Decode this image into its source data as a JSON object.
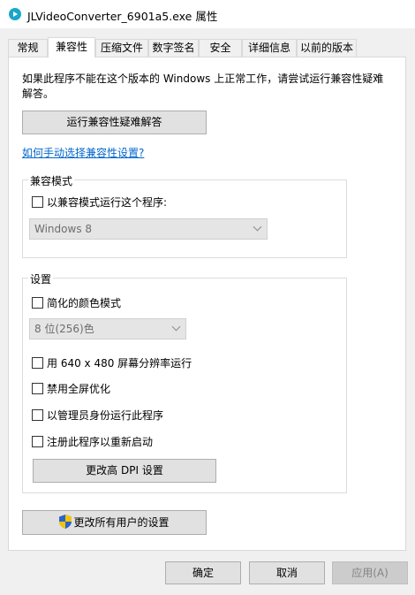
{
  "window": {
    "title": "JLVideoConverter_6901a5.exe 属性"
  },
  "tabs": [
    {
      "label": "常规"
    },
    {
      "label": "兼容性"
    },
    {
      "label": "压缩文件"
    },
    {
      "label": "数字签名"
    },
    {
      "label": "安全"
    },
    {
      "label": "详细信息"
    },
    {
      "label": "以前的版本"
    }
  ],
  "compat": {
    "intro": "如果此程序不能在这个版本的 Windows 上正常工作，请尝试运行兼容性疑难解答。",
    "troubleshoot_button": "运行兼容性疑难解答",
    "manual_link": "如何手动选择兼容性设置?",
    "mode_group": {
      "title": "兼容模式",
      "checkbox_label": "以兼容模式运行这个程序:",
      "os_select_value": "Windows 8"
    },
    "settings_group": {
      "title": "设置",
      "reduced_color": "简化的颜色模式",
      "color_select_value": "8 位(256)色",
      "res_640": "用 640 x 480 屏幕分辨率运行",
      "disable_fullscreen": "禁用全屏优化",
      "run_as_admin": "以管理员身份运行此程序",
      "register_restart": "注册此程序以重新启动",
      "dpi_button": "更改高 DPI 设置"
    },
    "all_users_button": "更改所有用户的设置"
  },
  "footer": {
    "ok": "确定",
    "cancel": "取消",
    "apply": "应用(A)"
  },
  "colors": {
    "link": "#0066cc",
    "app_icon": "#1aa7c9",
    "shield_blue": "#2a64c8",
    "shield_yellow": "#f4c400"
  }
}
